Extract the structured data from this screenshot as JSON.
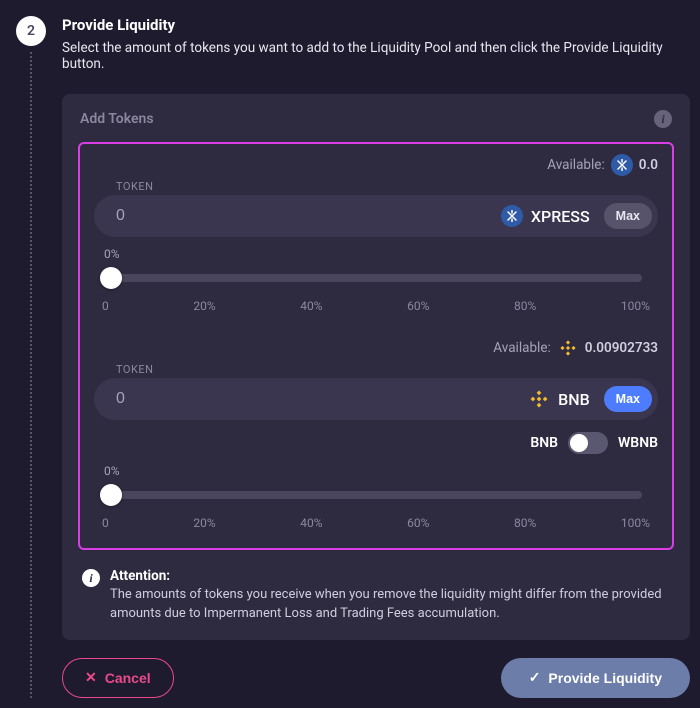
{
  "step": {
    "number": "2",
    "title": "Provide Liquidity",
    "description": "Select the amount of tokens you want to add to the Liquidity Pool and then click the Provide Liquidity button."
  },
  "card": {
    "title": "Add Tokens"
  },
  "tokenA": {
    "label": "TOKEN",
    "available_label": "Available:",
    "available_value": "0.0",
    "input_value": "0",
    "symbol": "XPRESS",
    "max_label": "Max",
    "slider_pct": "0%",
    "ticks": [
      "0",
      "20%",
      "40%",
      "60%",
      "80%",
      "100%"
    ]
  },
  "tokenB": {
    "label": "TOKEN",
    "available_label": "Available:",
    "available_value": "0.00902733",
    "input_value": "0",
    "symbol": "BNB",
    "max_label": "Max",
    "toggle_left": "BNB",
    "toggle_right": "WBNB",
    "slider_pct": "0%",
    "ticks": [
      "0",
      "20%",
      "40%",
      "60%",
      "80%",
      "100%"
    ]
  },
  "attention": {
    "title": "Attention:",
    "body": "The amounts of tokens you receive when you remove the liquidity might differ from the provided amounts due to Impermanent Loss and Trading Fees accumulation."
  },
  "actions": {
    "cancel": "Cancel",
    "submit": "Provide Liquidity"
  }
}
